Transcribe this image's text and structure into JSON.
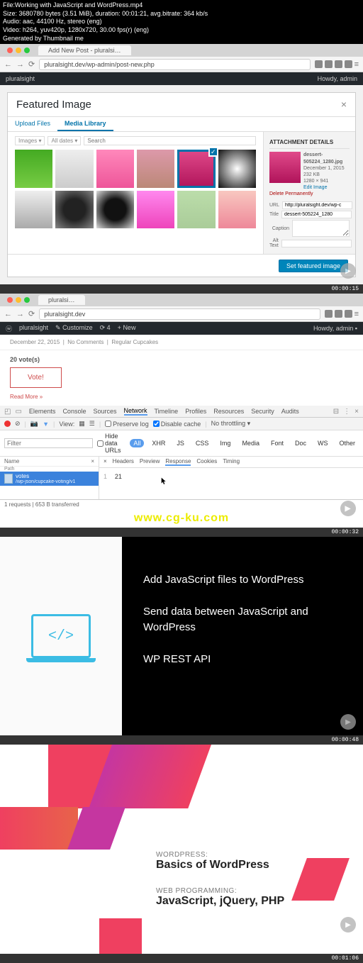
{
  "meta": {
    "file": "File:Working with JavaScript and WordPress.mp4",
    "size": "Size: 3680780 bytes (3.51 MiB), duration: 00:01:21, avg.bitrate: 364 kb/s",
    "audio": "Audio: aac, 44100 Hz, stereo (eng)",
    "video": "Video: h264, yuv420p, 1280x720, 30.00 fps(r) (eng)",
    "gen": "Generated by Thumbnail me"
  },
  "browser1": {
    "tab": "Add New Post - pluralsi…",
    "url": "pluralsight.dev/wp-admin/post-new.php"
  },
  "wpbar1": {
    "site": "pluralsight",
    "howdy": "Howdy, admin"
  },
  "modal": {
    "title": "Featured Image",
    "tabs": {
      "upload": "Upload Files",
      "library": "Media Library"
    },
    "filters": {
      "type": "Images",
      "date": "All dates",
      "search": "Search"
    },
    "attach": {
      "heading": "ATTACHMENT DETAILS",
      "filename": "dessert-505224_1280.jpg",
      "date": "December 1, 2015",
      "filesize": "232 KB",
      "dims": "1280 × 941",
      "edit": "Edit Image",
      "delete": "Delete Permanently",
      "url_lbl": "URL",
      "url_val": "http://pluralsight.dev/wp-c",
      "title_lbl": "Title",
      "title_val": "dessert-505224_1280",
      "caption_lbl": "Caption",
      "alt_lbl": "Alt Text"
    },
    "set_btn": "Set featured image",
    "close": "×"
  },
  "ts1": "00:00:15",
  "browser2": {
    "tab": "pluralsi…",
    "url": "pluralsight.dev"
  },
  "wpbar2": {
    "site": "pluralsight",
    "customize": "Customize",
    "updates": "4",
    "new": "New",
    "howdy": "Howdy, admin"
  },
  "post": {
    "date": "December 22, 2015",
    "comments": "No Comments",
    "cat": "Regular Cupcakes",
    "votes": "20 vote(s)",
    "vote_btn": "Vote!",
    "readmore": "Read More »"
  },
  "devtools": {
    "tabs": [
      "Elements",
      "Console",
      "Sources",
      "Network",
      "Timeline",
      "Profiles",
      "Resources",
      "Security",
      "Audits"
    ],
    "active_tab": "Network",
    "view": "View:",
    "preserve": "Preserve log",
    "disable_cache": "Disable cache",
    "throttle": "No throttling",
    "filter": "Filter",
    "hide": "Hide data URLs",
    "types": [
      "All",
      "XHR",
      "JS",
      "CSS",
      "Img",
      "Media",
      "Font",
      "Doc",
      "WS",
      "Other"
    ],
    "list_head": {
      "name": "Name",
      "path": "Path"
    },
    "req": {
      "name": "votes",
      "path": "/wp-json/cupcake-voting/v1"
    },
    "detail_tabs": [
      "Headers",
      "Preview",
      "Response",
      "Cookies",
      "Timing"
    ],
    "active_detail": "Response",
    "response_line": "1",
    "response_body": "21",
    "status": "1 requests  |  653 B transferred"
  },
  "watermark": "www.cg-ku.com",
  "ts2": "00:00:32",
  "slide1": {
    "l1": "Add JavaScript files to WordPress",
    "l2": "Send data between JavaScript and WordPress",
    "l3": "WP REST API",
    "code": "</>"
  },
  "ts3": "00:00:48",
  "slide2": {
    "k1": "WORDPRESS:",
    "h1": "Basics of WordPress",
    "k2": "WEB PROGRAMMING:",
    "h2": "JavaScript, jQuery, PHP"
  },
  "ts4": "00:01:06"
}
